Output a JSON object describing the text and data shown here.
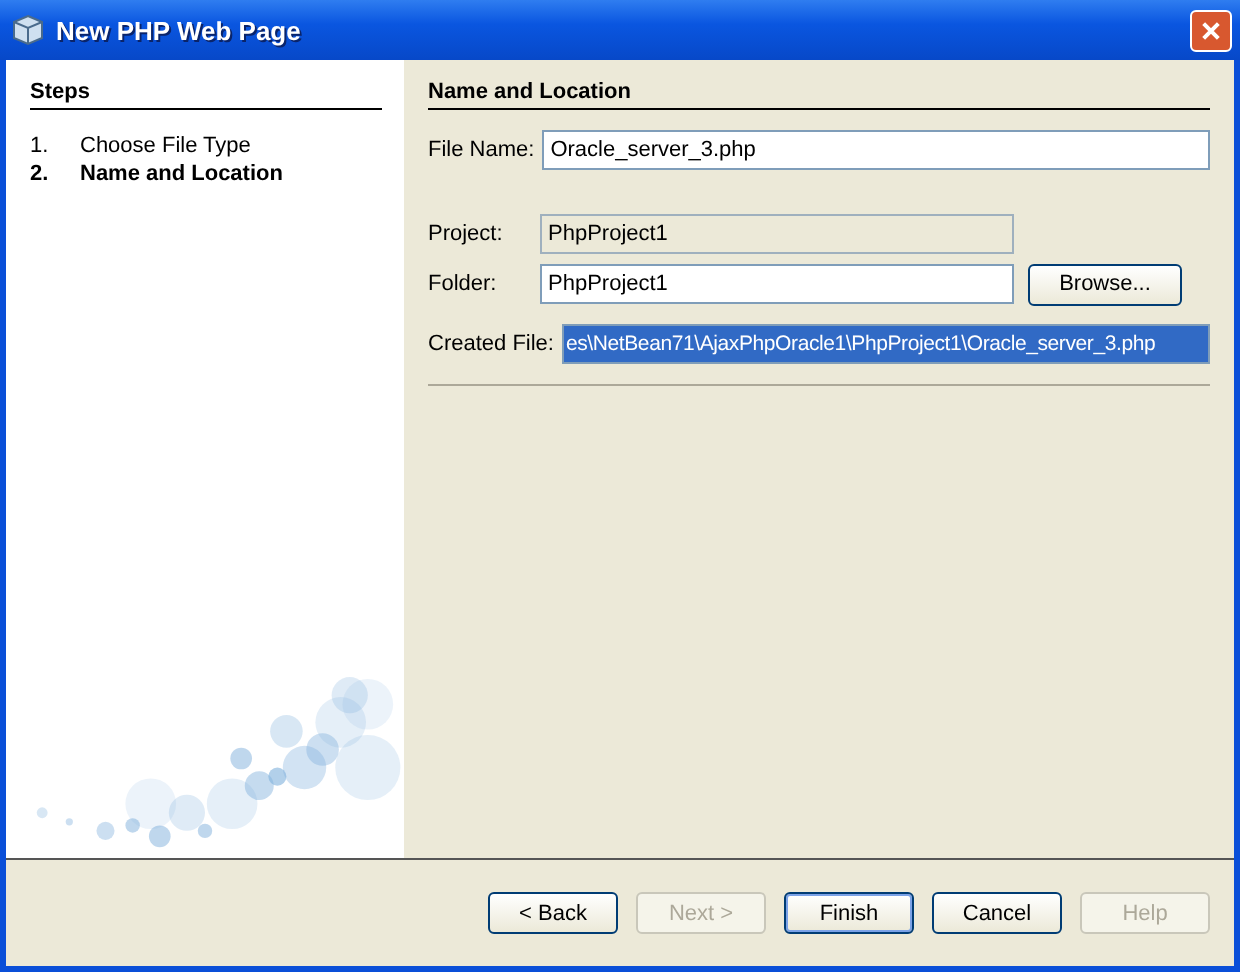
{
  "window": {
    "title": "New PHP Web Page"
  },
  "steps": {
    "title": "Steps",
    "items": [
      {
        "number": "1.",
        "label": "Choose File Type",
        "selected": false
      },
      {
        "number": "2.",
        "label": "Name and Location",
        "selected": true
      }
    ]
  },
  "panel": {
    "title": "Name and Location",
    "field_groups": [
      [
        {
          "label": "File Name:",
          "value": "Oracle_server_3.php",
          "kind": "editable"
        }
      ],
      [
        {
          "label": "Project:",
          "value": "PhpProject1",
          "kind": "readonly"
        },
        {
          "label": "Folder:",
          "value": "PhpProject1",
          "kind": "editable",
          "button": "Browse..."
        }
      ],
      [
        {
          "label": "Created File:",
          "value": "es\\NetBean71\\AjaxPhpOracle1\\PhpProject1\\Oracle_server_3.php",
          "kind": "selected"
        }
      ]
    ]
  },
  "buttons": [
    {
      "label": "< Back",
      "disabled": false,
      "default": false
    },
    {
      "label": "Next >",
      "disabled": true,
      "default": false
    },
    {
      "label": "Finish",
      "disabled": false,
      "default": true
    },
    {
      "label": "Cancel",
      "disabled": false,
      "default": false
    },
    {
      "label": "Help",
      "disabled": true,
      "default": false
    }
  ]
}
